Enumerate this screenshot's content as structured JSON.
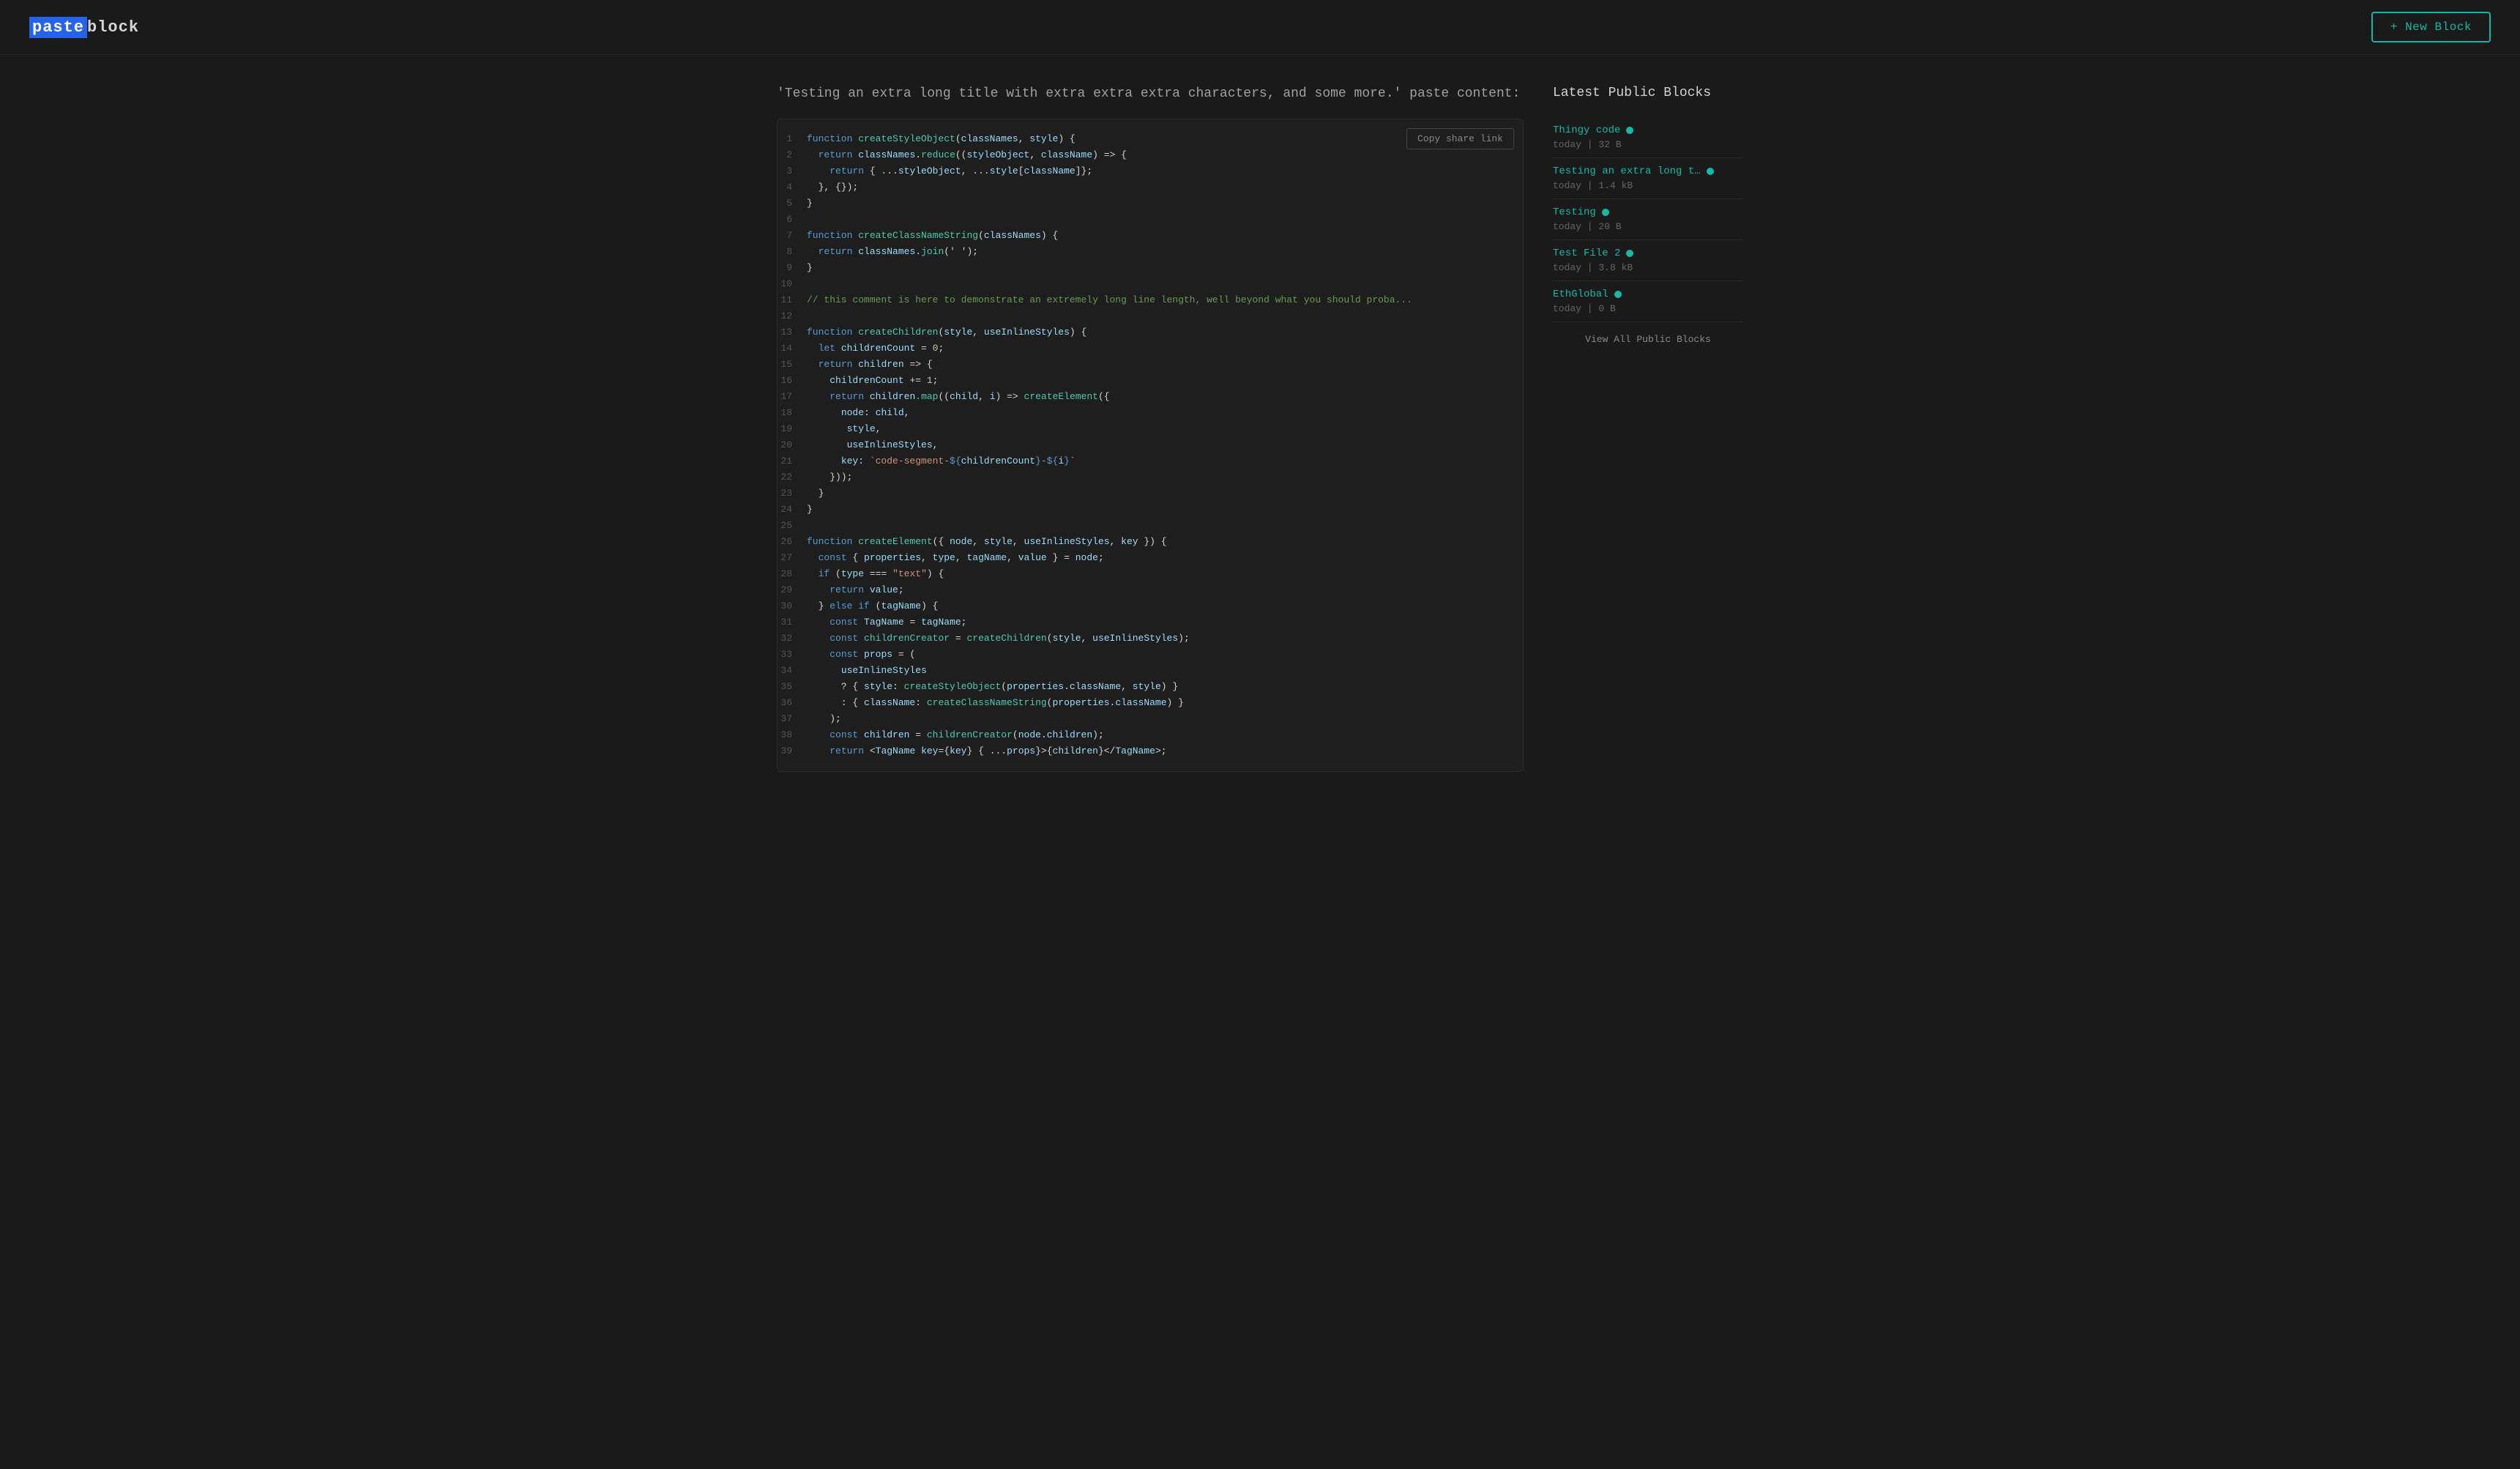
{
  "header": {
    "logo_paste": "paste",
    "logo_block": "block",
    "new_block_label": "+ New Block"
  },
  "paste": {
    "title": "'Testing an extra long title with extra extra extra characters, and some more.' paste content:",
    "copy_share_link": "Copy share link"
  },
  "code_lines": [
    {
      "num": "1",
      "content": "function createStyleObject(classNames, style) {"
    },
    {
      "num": "2",
      "content": "  return classNames.reduce((styleObject, className) => {"
    },
    {
      "num": "3",
      "content": "    return { ...styleObject, ...style[className]};"
    },
    {
      "num": "4",
      "content": "  }, {});"
    },
    {
      "num": "5",
      "content": "}"
    },
    {
      "num": "6",
      "content": ""
    },
    {
      "num": "7",
      "content": "function createClassNameString(classNames) {"
    },
    {
      "num": "8",
      "content": "  return classNames.join(' ');"
    },
    {
      "num": "9",
      "content": "}"
    },
    {
      "num": "10",
      "content": ""
    },
    {
      "num": "11",
      "content": "// this comment is here to demonstrate an extremely long line length, well beyond what you should proba..."
    },
    {
      "num": "12",
      "content": ""
    },
    {
      "num": "13",
      "content": "function createChildren(style, useInlineStyles) {"
    },
    {
      "num": "14",
      "content": "  let childrenCount = 0;"
    },
    {
      "num": "15",
      "content": "  return children => {"
    },
    {
      "num": "16",
      "content": "    childrenCount += 1;"
    },
    {
      "num": "17",
      "content": "    return children.map((child, i) => createElement({"
    },
    {
      "num": "18",
      "content": "      node: child,"
    },
    {
      "num": "19",
      "content": "       style,"
    },
    {
      "num": "20",
      "content": "       useInlineStyles,"
    },
    {
      "num": "21",
      "content": "      key: `code-segment-${childrenCount}-${i}`"
    },
    {
      "num": "22",
      "content": "    }));"
    },
    {
      "num": "23",
      "content": "  }"
    },
    {
      "num": "24",
      "content": "}"
    },
    {
      "num": "25",
      "content": ""
    },
    {
      "num": "26",
      "content": "function createElement({ node, style, useInlineStyles, key }) {"
    },
    {
      "num": "27",
      "content": "  const { properties, type, tagName, value } = node;"
    },
    {
      "num": "28",
      "content": "  if (type === \"text\") {"
    },
    {
      "num": "29",
      "content": "    return value;"
    },
    {
      "num": "30",
      "content": "  } else if (tagName) {"
    },
    {
      "num": "31",
      "content": "    const TagName = tagName;"
    },
    {
      "num": "32",
      "content": "    const childrenCreator = createChildren(style, useInlineStyles);"
    },
    {
      "num": "33",
      "content": "    const props = ("
    },
    {
      "num": "34",
      "content": "      useInlineStyles"
    },
    {
      "num": "35",
      "content": "      ? { style: createStyleObject(properties.className, style) }"
    },
    {
      "num": "36",
      "content": "      : { className: createClassNameString(properties.className) }"
    },
    {
      "num": "37",
      "content": "    );"
    },
    {
      "num": "38",
      "content": "    const children = childrenCreator(node.children);"
    },
    {
      "num": "39",
      "content": "    return <TagName key={key} { ...props}>{children}</TagName>;"
    }
  ],
  "sidebar": {
    "title": "Latest Public Blocks",
    "blocks": [
      {
        "name": "Thingy code",
        "meta": "today | 32 B"
      },
      {
        "name": "Testing an extra long t…",
        "meta": "today | 1.4 kB"
      },
      {
        "name": "Testing",
        "meta": "today | 20 B"
      },
      {
        "name": "Test File 2",
        "meta": "today | 3.8 kB"
      },
      {
        "name": "EthGlobal",
        "meta": "today | 0 B"
      }
    ],
    "view_all_label": "View All Public Blocks"
  }
}
